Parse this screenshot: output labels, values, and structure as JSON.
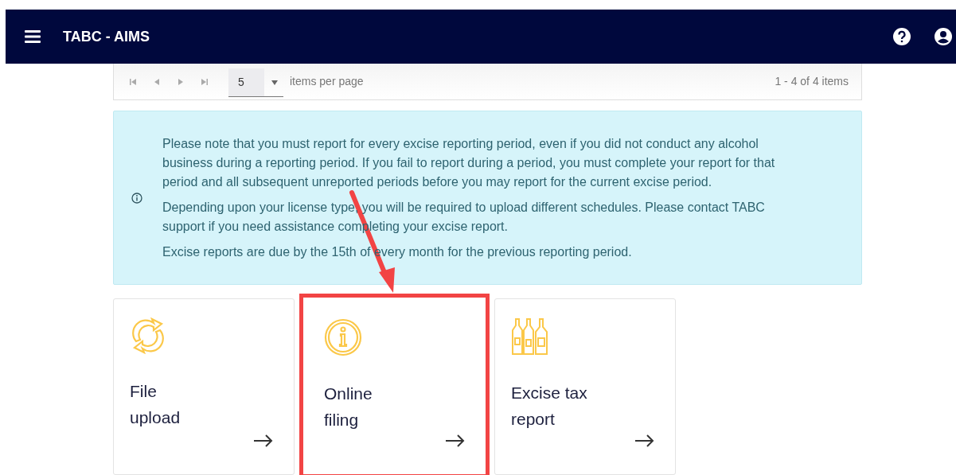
{
  "app_bar": {
    "title": "TABC - AIMS"
  },
  "pager": {
    "page_size": "5",
    "page_size_label": "items per page",
    "range": "1 - 4 of 4 items"
  },
  "notice": {
    "paragraphs": [
      "Please note that you must report for every excise reporting period, even if you did not conduct any alcohol business during a reporting period. If you fail to report during a period, you must complete your report for that period and all subsequent unreported periods before you may report for the current excise period.",
      "Depending upon your license type, you will be required to upload different schedules. Please contact TABC support if you need assistance completing your excise report.",
      "Excise reports are due by the 15th of every month for the previous reporting period."
    ]
  },
  "cards": [
    {
      "kind": "upload",
      "label": "File upload",
      "highlighted": false
    },
    {
      "kind": "online",
      "label": "Online filing",
      "highlighted": true
    },
    {
      "kind": "excise",
      "label": "Excise tax report",
      "highlighted": false
    }
  ]
}
